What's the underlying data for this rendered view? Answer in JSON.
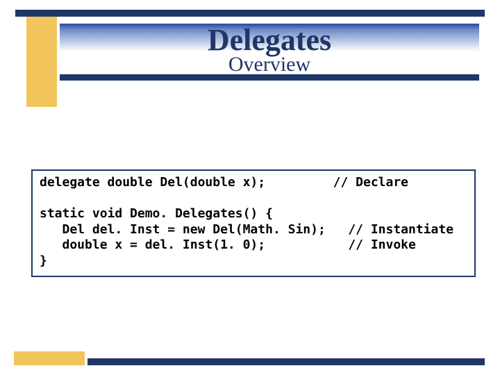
{
  "header": {
    "title": "Delegates",
    "subtitle": "Overview"
  },
  "code": {
    "line1": "delegate double Del(double x);         // Declare",
    "line2": "",
    "line3": "static void Demo. Delegates() {",
    "line4": "   Del del. Inst = new Del(Math. Sin);   // Instantiate",
    "line5": "   double x = del. Inst(1. 0);           // Invoke",
    "line6": "}"
  }
}
